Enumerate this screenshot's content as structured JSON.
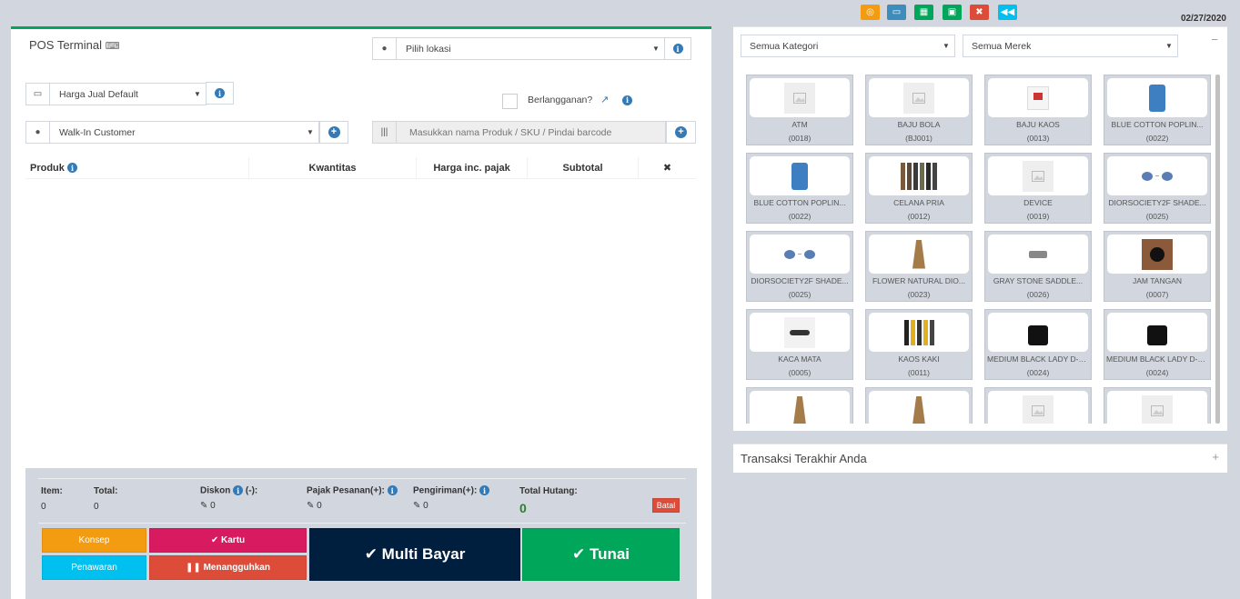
{
  "date": "02/27/2020",
  "toolbar": {
    "colors": [
      "#f39c12",
      "#3c8dbc",
      "#00a65a",
      "#00a65a",
      "#dd4b39",
      "#00c0ef"
    ],
    "icons": [
      "register-icon",
      "window-icon",
      "calculator-icon",
      "briefcase-icon",
      "close-icon",
      "rewind-icon"
    ]
  },
  "pos": {
    "title": "POS Terminal",
    "location": "Pilih lokasi",
    "price_group": "Harga Jual Default",
    "subscribe_label": "Berlangganan?",
    "customer": "Walk-In Customer",
    "search_placeholder": "Masukkan nama Produk / SKU / Pindai barcode"
  },
  "table": {
    "headers": [
      "Produk",
      "Kwantitas",
      "Harga inc. pajak",
      "Subtotal",
      "✖"
    ]
  },
  "summary": {
    "item_label": "Item:",
    "item_value": "0",
    "total_label": "Total:",
    "total_value": "0",
    "discount_label": "Diskon",
    "discount_suffix": "(-):",
    "discount_value": "0",
    "tax_label": "Pajak Pesanan(+):",
    "tax_value": "0",
    "shipping_label": "Pengiriman(+):",
    "shipping_value": "0",
    "due_label": "Total Hutang:",
    "due_value": "0",
    "cancel": "Batal"
  },
  "actions": {
    "draft": "Konsep",
    "card": "Kartu",
    "quotation": "Penawaran",
    "suspend": "Menangguhkan",
    "multi_pay": "Multi Bayar",
    "cash": "Tunai"
  },
  "filters": {
    "category": "Semua Kategori",
    "brand": "Semua Merek"
  },
  "products": [
    {
      "name": "ATM",
      "sku": "(0018)",
      "img": "placeholder"
    },
    {
      "name": "BAJU BOLA",
      "sku": "(BJ001)",
      "img": "placeholder"
    },
    {
      "name": "BAJU KAOS",
      "sku": "(0013)",
      "img": "tshirt"
    },
    {
      "name": "BLUE COTTON POPLIN...",
      "sku": "(0022)",
      "img": "shirt"
    },
    {
      "name": "BLUE COTTON POPLIN...",
      "sku": "(0022)",
      "img": "shirt"
    },
    {
      "name": "CELANA PRIA",
      "sku": "(0012)",
      "img": "pants"
    },
    {
      "name": "DEVICE",
      "sku": "(0019)",
      "img": "placeholder"
    },
    {
      "name": "DIORSOCIETY2F SHADE...",
      "sku": "(0025)",
      "img": "glasses"
    },
    {
      "name": "DIORSOCIETY2F SHADE...",
      "sku": "(0025)",
      "img": "glasses"
    },
    {
      "name": "FLOWER NATURAL DIO...",
      "sku": "(0023)",
      "img": "dress"
    },
    {
      "name": "GRAY STONE SADDLE...",
      "sku": "(0026)",
      "img": "bag-gray"
    },
    {
      "name": "JAM TANGAN",
      "sku": "(0007)",
      "img": "watch"
    },
    {
      "name": "KACA MATA",
      "sku": "(0005)",
      "img": "glasses2"
    },
    {
      "name": "KAOS KAKI",
      "sku": "(0011)",
      "img": "socks"
    },
    {
      "name": "MEDIUM BLACK LADY D-LI...",
      "sku": "(0024)",
      "img": "bag"
    },
    {
      "name": "MEDIUM BLACK LADY D-LI...",
      "sku": "(0024)",
      "img": "bag"
    },
    {
      "name": "",
      "sku": "",
      "img": "dress"
    },
    {
      "name": "",
      "sku": "",
      "img": "dress"
    },
    {
      "name": "",
      "sku": "",
      "img": "placeholder"
    },
    {
      "name": "",
      "sku": "",
      "img": "placeholder"
    }
  ],
  "recent": {
    "title": "Transaksi Terakhir Anda"
  }
}
